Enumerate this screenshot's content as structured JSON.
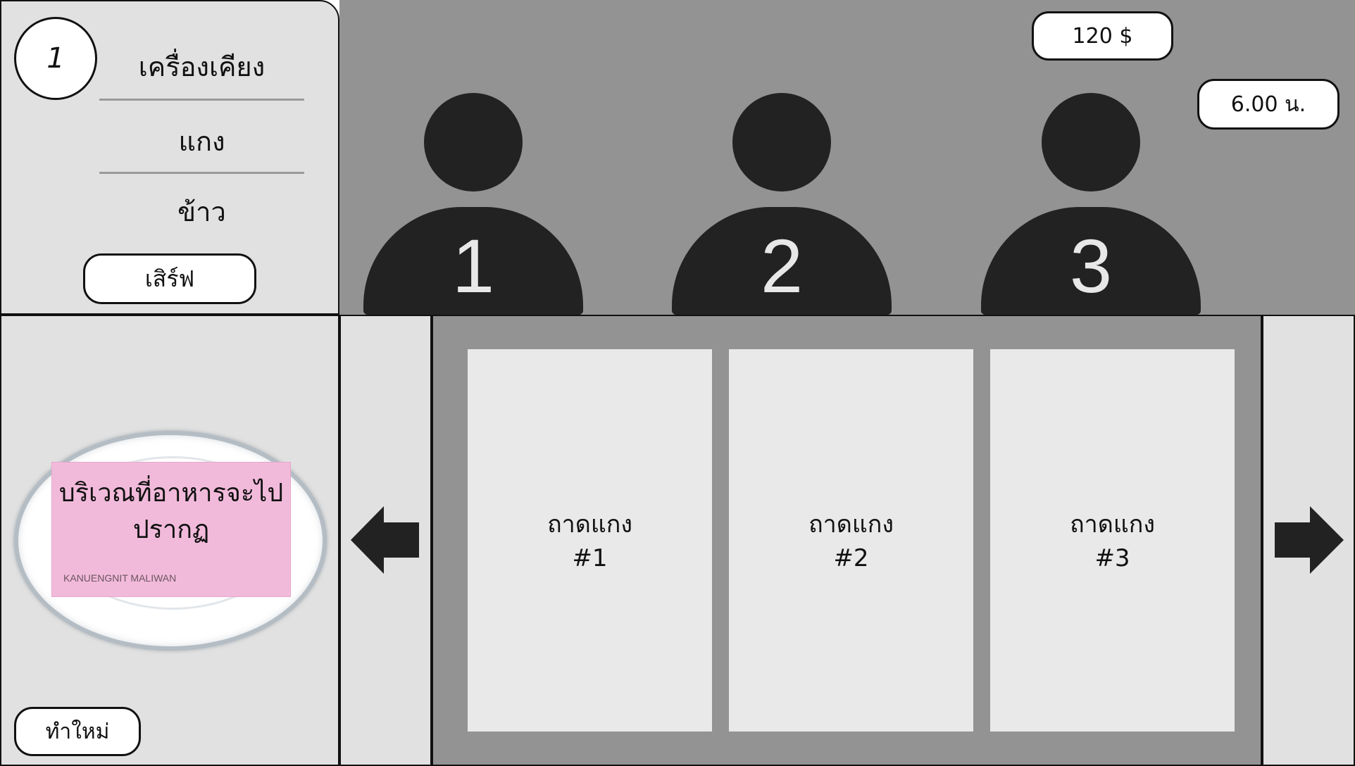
{
  "order": {
    "number": "1",
    "items": [
      "เครื่องเคียง",
      "แกง",
      "ข้าว"
    ],
    "serve_label": "เสิร์ฟ"
  },
  "status": {
    "money": "120 $",
    "time": "6.00 น."
  },
  "customers": [
    "1",
    "2",
    "3"
  ],
  "plate": {
    "note_text": "บริเวณที่อาหารจะไปปรากฏ",
    "note_author": "KANUENGNIT MALIWAN",
    "reset_label": "ทำใหม่"
  },
  "trays": [
    {
      "label": "ถาดแกง",
      "number": "#1"
    },
    {
      "label": "ถาดแกง",
      "number": "#2"
    },
    {
      "label": "ถาดแกง",
      "number": "#3"
    }
  ],
  "colors": {
    "panel": "#e1e1e1",
    "backdrop": "#939393",
    "customer": "#222222",
    "tray": "#e9e9e9",
    "note": "#f2bada"
  }
}
